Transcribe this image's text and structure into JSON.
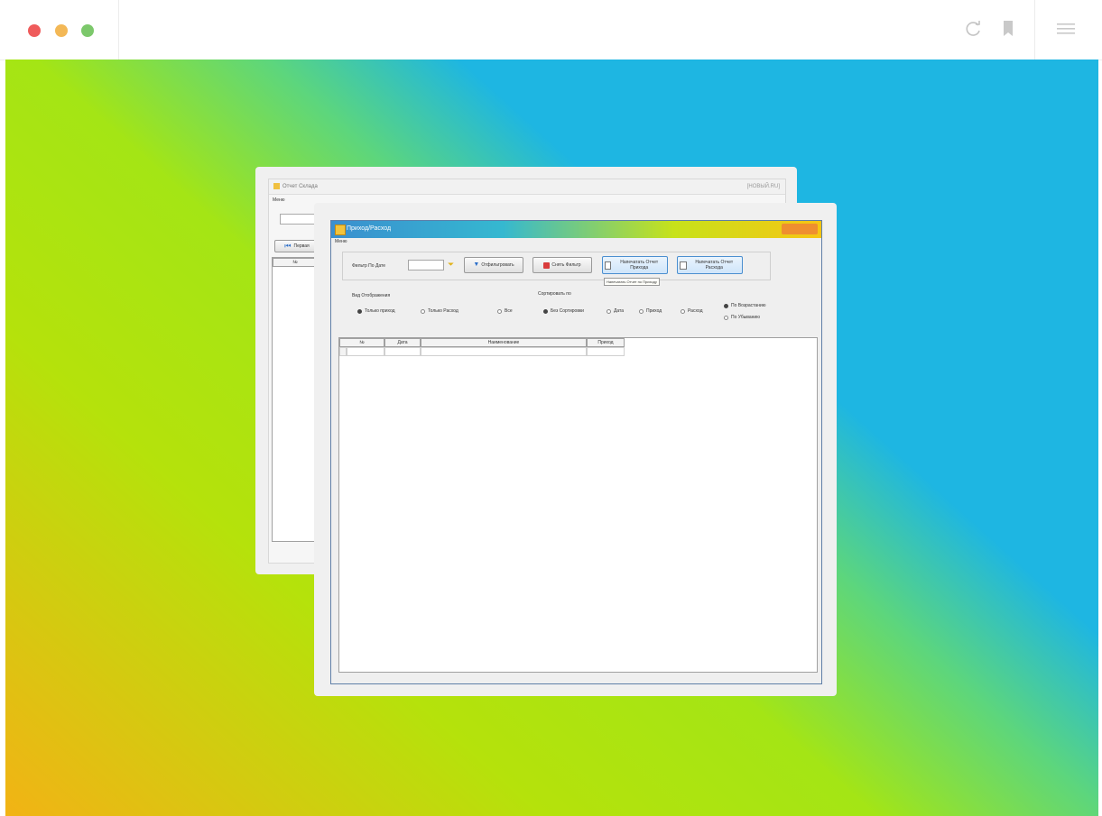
{
  "browser": {
    "icons": [
      "reload-icon",
      "bookmark-icon",
      "menu-icon"
    ]
  },
  "back_window": {
    "title": "Отчет Склада",
    "title_right": "[НОВЫЙ.RU]",
    "menu": "Меню",
    "first_button": "Первая",
    "grid_header": "№"
  },
  "front_window": {
    "title": "Приход/Расход",
    "menu": "Меню",
    "filter": {
      "date_label": "Фильтр По Дате",
      "date_value": "",
      "apply_button": "Отфильтровать",
      "clear_button": "Снять Фильтр",
      "report_income_button": "Напечатать Отчет Прихода",
      "report_expense_button": "Напечатать Отчет Расхода",
      "tooltip": "Напечатать Отчет по Приходу"
    },
    "display_mode": {
      "label": "Вид Отображения",
      "options": [
        {
          "label": "Только приход",
          "checked": true
        },
        {
          "label": "Только Расход",
          "checked": false
        },
        {
          "label": "Все",
          "checked": false
        }
      ]
    },
    "sort": {
      "label": "Сортировать по",
      "options": [
        {
          "label": "Без Сортировки",
          "checked": true
        },
        {
          "label": "Дата",
          "checked": false
        },
        {
          "label": "Приход",
          "checked": false
        },
        {
          "label": "Расход",
          "checked": false
        }
      ],
      "order": [
        {
          "label": "По Возрастанию",
          "checked": true
        },
        {
          "label": "По Убыванию",
          "checked": false
        }
      ]
    },
    "grid": {
      "columns": [
        "№",
        "Дата",
        "Наименование",
        "Приход"
      ]
    }
  }
}
